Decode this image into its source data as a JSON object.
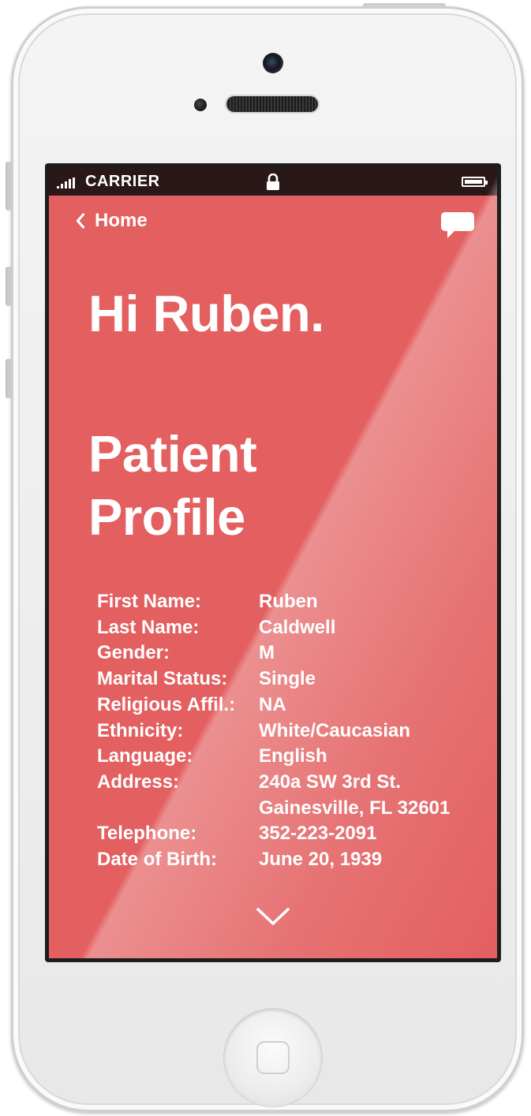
{
  "status_bar": {
    "carrier": "CARRIER",
    "signal_icon": "signal-bars-icon",
    "lock_icon": "lock-icon",
    "battery_icon": "battery-icon"
  },
  "nav": {
    "back_label": "Home",
    "back_icon": "chevron-left-icon",
    "chat_icon": "chat-bubble-icon"
  },
  "greeting": "Hi Ruben.",
  "title": "Patient Profile",
  "profile": [
    {
      "label": "First Name:",
      "value": "Ruben"
    },
    {
      "label": "Last Name:",
      "value": "Caldwell"
    },
    {
      "label": "Gender:",
      "value": "M"
    },
    {
      "label": "Marital Status:",
      "value": "Single"
    },
    {
      "label": "Religious Affil.:",
      "value": "NA"
    },
    {
      "label": "Ethnicity:",
      "value": "White/Caucasian"
    },
    {
      "label": "Language:",
      "value": "English"
    },
    {
      "label": "Address:",
      "value": "240a SW 3rd St."
    },
    {
      "label": "",
      "value": "Gainesville, FL 32601"
    },
    {
      "label": "Telephone:",
      "value": "352-223-2091"
    },
    {
      "label": "Date of Birth:",
      "value": "June 20, 1939"
    }
  ],
  "scroll_icon": "chevron-down-icon",
  "colors": {
    "screen_background": "#e35f60",
    "status_bar": "#2a1717",
    "text": "#ffffff"
  }
}
